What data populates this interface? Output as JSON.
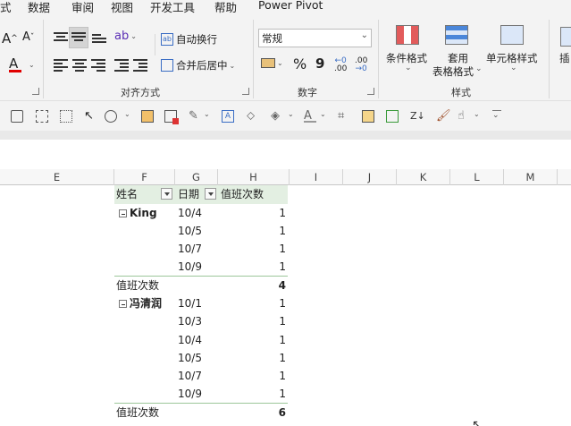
{
  "menubar": {
    "items": [
      "式",
      "数据",
      "审阅",
      "视图",
      "开发工具",
      "帮助",
      "Power Pivot"
    ]
  },
  "ribbon": {
    "alignment": {
      "label": "对齐方式",
      "wrap_text": "自动换行",
      "merge_center": "合并后居中"
    },
    "number": {
      "label": "数字",
      "format_value": "常规",
      "percent_symbol": "%",
      "comma_symbol": "9",
      "inc_decimal": ".00",
      "dec_decimal": ".00"
    },
    "styles": {
      "label": "样式",
      "conditional": "条件格式",
      "table_format_line1": "套用",
      "table_format_line2": "表格格式",
      "cell_styles": "单元格样式"
    },
    "font": {
      "grow": "A",
      "shrink": "A",
      "color_letter": "A",
      "font_color": "#e00000"
    },
    "insert_partial": "插"
  },
  "sheet": {
    "columns": [
      "E",
      "F",
      "G",
      "H",
      "I",
      "J",
      "K",
      "L",
      "M"
    ],
    "pivot": {
      "header": {
        "name": "姓名",
        "date": "日期",
        "value": "值班次数"
      },
      "groups": [
        {
          "name": "King",
          "rows": [
            {
              "date": "10/4",
              "count": "1"
            },
            {
              "date": "10/5",
              "count": "1"
            },
            {
              "date": "10/7",
              "count": "1"
            },
            {
              "date": "10/9",
              "count": "1"
            }
          ],
          "total_label": "值班次数",
          "total": "4"
        },
        {
          "name": "冯清润",
          "rows": [
            {
              "date": "10/1",
              "count": "1"
            },
            {
              "date": "10/3",
              "count": "1"
            },
            {
              "date": "10/4",
              "count": "1"
            },
            {
              "date": "10/5",
              "count": "1"
            },
            {
              "date": "10/7",
              "count": "1"
            },
            {
              "date": "10/9",
              "count": "1"
            }
          ],
          "total_label": "值班次数",
          "total": "6"
        }
      ]
    }
  },
  "colors": {
    "pivot_header_bg": "#e3efe2",
    "ribbon_bg": "#f3f3f3"
  }
}
